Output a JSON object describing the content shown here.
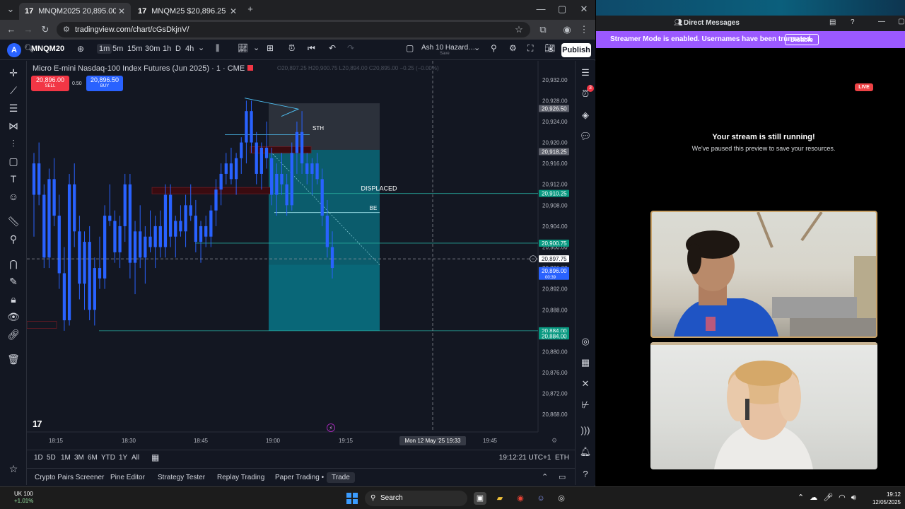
{
  "browser": {
    "tabs": [
      {
        "label": "MNQM2025 20,895.00 ▲ +3.77…",
        "favicon": "17"
      },
      {
        "label": "MNQM25 $20,896.25 ▲ +3.77…",
        "favicon": "17"
      }
    ],
    "url": "tradingview.com/chart/cGsDkjnV/"
  },
  "toolbar": {
    "avatar": "A",
    "symbol": "MNQM20",
    "timeframes": [
      "1m",
      "5m",
      "15m",
      "30m",
      "1h",
      "D",
      "4h"
    ],
    "layout_name": "Ash 10 Hazard…",
    "layout_save": "Save",
    "publish": "Publish"
  },
  "chart": {
    "title": "Micro E-mini Nasdaq-100 Index Futures (Jun 2025) · 1 · CME",
    "ohlc": "O20,897.25 H20,900.75 L20,894.00 C20,895.00 −0.25 (−0.00%)",
    "sell_price": "20,896.00",
    "sell_label": "SELL",
    "buy_price": "20,896.50",
    "buy_label": "BUY",
    "spread": "0.50",
    "logo": "17",
    "crosshair_date": "Mon 12 May '25   19:33"
  },
  "chart_data": {
    "type": "candlestick",
    "title": "Micro E-mini Nasdaq-100 Index Futures (Jun 2025) · 1 · CME",
    "y_ticks": [
      "20,932.00",
      "20,928.00",
      "20,924.00",
      "20,920.00",
      "20,916.00",
      "20,912.00",
      "20,908.00",
      "20,904.00",
      "20,900.00",
      "20,896.00",
      "20,892.00",
      "20,888.00",
      "20,884.00",
      "20,880.00",
      "20,876.00",
      "20,872.00",
      "20,868.00"
    ],
    "x_ticks": [
      "18:15",
      "18:30",
      "18:45",
      "19:00",
      "19:15",
      "19:30",
      "19:45"
    ],
    "ylim": [
      20866,
      20934
    ],
    "price_labels": [
      {
        "price": 20926.5,
        "text": "20,926.50",
        "color": "#5d606b"
      },
      {
        "price": 20918.25,
        "text": "20,918.25",
        "color": "#5d606b"
      },
      {
        "price": 20910.25,
        "text": "20,910.25",
        "color": "#089981"
      },
      {
        "price": 20900.75,
        "text": "20,900.75",
        "color": "#089981"
      },
      {
        "price": 20897.75,
        "text": "20,897.75",
        "color": "#131722"
      },
      {
        "price": 20895.5,
        "text": "20,896.00",
        "sub": "00:39",
        "color": "#2962ff"
      },
      {
        "price": 20884.0,
        "text": "20,884.00",
        "color": "#089981"
      },
      {
        "price": 20883.0,
        "text": "20,884.00",
        "color": "#089981"
      }
    ],
    "annotations": [
      {
        "text": "STH"
      },
      {
        "text": "DISPLACED"
      },
      {
        "text": "BE"
      }
    ],
    "candles": [
      [
        20910,
        20918,
        20902,
        20916
      ],
      [
        20916,
        20920,
        20908,
        20910
      ],
      [
        20910,
        20912,
        20896,
        20898
      ],
      [
        20898,
        20915,
        20896,
        20913
      ],
      [
        20913,
        20917,
        20904,
        20906
      ],
      [
        20906,
        20910,
        20892,
        20895
      ],
      [
        20895,
        20900,
        20884,
        20886
      ],
      [
        20886,
        20914,
        20885,
        20912
      ],
      [
        20912,
        20916,
        20900,
        20903
      ],
      [
        20903,
        20906,
        20890,
        20893
      ],
      [
        20893,
        20903,
        20888,
        20901
      ],
      [
        20901,
        20904,
        20886,
        20888
      ],
      [
        20888,
        20898,
        20885,
        20896
      ],
      [
        20896,
        20902,
        20892,
        20894
      ],
      [
        20894,
        20908,
        20892,
        20906
      ],
      [
        20906,
        20912,
        20904,
        20905
      ],
      [
        20905,
        20907,
        20897,
        20899
      ],
      [
        20899,
        20906,
        20896,
        20904
      ],
      [
        20904,
        20914,
        20901,
        20912
      ],
      [
        20912,
        20914,
        20894,
        20897
      ],
      [
        20897,
        20905,
        20891,
        20903
      ],
      [
        20903,
        20908,
        20896,
        20898
      ],
      [
        20898,
        20904,
        20893,
        20902
      ],
      [
        20902,
        20907,
        20899,
        20900
      ],
      [
        20900,
        20906,
        20896,
        20904
      ],
      [
        20904,
        20907,
        20898,
        20900
      ],
      [
        20900,
        20912,
        20898,
        20910
      ],
      [
        20910,
        20912,
        20900,
        20902
      ],
      [
        20902,
        20906,
        20898,
        20905
      ],
      [
        20905,
        20908,
        20902,
        20903
      ],
      [
        20903,
        20910,
        20900,
        20908
      ],
      [
        20908,
        20912,
        20905,
        20906
      ],
      [
        20906,
        20909,
        20899,
        20901
      ],
      [
        20901,
        20905,
        20897,
        20904
      ],
      [
        20904,
        20906,
        20900,
        20902
      ],
      [
        20902,
        20908,
        20900,
        20907
      ],
      [
        20907,
        20913,
        20904,
        20911
      ],
      [
        20911,
        20916,
        20908,
        20914
      ],
      [
        20914,
        20918,
        20912,
        20916
      ],
      [
        20916,
        20919,
        20912,
        20913
      ],
      [
        20913,
        20918,
        20910,
        20917
      ],
      [
        20917,
        20921,
        20914,
        20920
      ],
      [
        20920,
        20928,
        20916,
        20926
      ],
      [
        20926,
        20928,
        20918,
        20920
      ],
      [
        20920,
        20922,
        20912,
        20914
      ],
      [
        20914,
        20920,
        20911,
        20919
      ],
      [
        20919,
        20924,
        20915,
        20917
      ],
      [
        20917,
        20919,
        20908,
        20910
      ],
      [
        20910,
        20916,
        20906,
        20914
      ],
      [
        20914,
        20918,
        20910,
        20912
      ],
      [
        20912,
        20914,
        20906,
        20908
      ],
      [
        20908,
        20920,
        20907,
        20918
      ],
      [
        20918,
        20924,
        20914,
        20922
      ],
      [
        20922,
        20926,
        20914,
        20916
      ],
      [
        20916,
        20918,
        20912,
        20914
      ],
      [
        20914,
        20917,
        20910,
        20916
      ],
      [
        20916,
        20918,
        20912,
        20913
      ],
      [
        20913,
        20915,
        20904,
        20906
      ],
      [
        20906,
        20909,
        20898,
        20900
      ],
      [
        20900,
        20903,
        20894,
        20896
      ]
    ]
  },
  "rangebar": {
    "ranges": [
      "1D",
      "5D",
      "1M",
      "3M",
      "6M",
      "YTD",
      "1Y",
      "All"
    ],
    "clock": "19:12:21 UTC+1",
    "session": "ETH"
  },
  "footer": {
    "tabs": [
      "Crypto Pairs Screener",
      "Pine Editor",
      "Strategy Tester",
      "Replay Trading",
      "Paper Trading •",
      "Trade"
    ]
  },
  "discord": {
    "title": "Direct Messages",
    "banner": "Streamer Mode is enabled. Usernames have been truncated.",
    "disable": "Disable",
    "live": "LIVE",
    "stream_title": "Your stream is still running!",
    "stream_sub": "We've paused this preview to save your resources."
  },
  "taskbar": {
    "weather_title": "UK 100",
    "weather_sub": "+1.01%",
    "search": "Search",
    "time": "19:12",
    "date": "12/05/2025"
  },
  "colors": {
    "bg": "#131722",
    "candle": "#2962ff",
    "zone_cyan": "#00bcd4",
    "accent_green": "#089981",
    "sell": "#f23645",
    "buy": "#2962ff",
    "discord_banner": "#9b59ff"
  }
}
